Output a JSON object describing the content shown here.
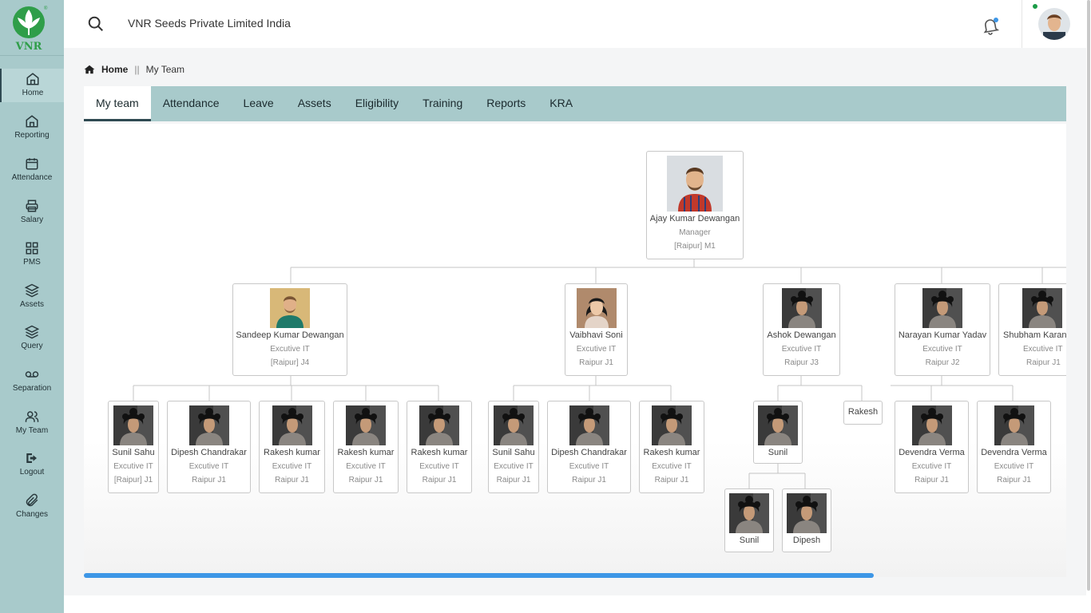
{
  "app": {
    "company_name": "VNR Seeds Private Limited India",
    "logo_text": "VNR"
  },
  "sidebar": {
    "items": [
      {
        "label": "Home",
        "icon": "home-icon",
        "active": true
      },
      {
        "label": "Reporting",
        "icon": "home-icon"
      },
      {
        "label": "Attendance",
        "icon": "calendar-icon"
      },
      {
        "label": "Salary",
        "icon": "printer-icon"
      },
      {
        "label": "PMS",
        "icon": "grid-icon"
      },
      {
        "label": "Assets",
        "icon": "layers-icon"
      },
      {
        "label": "Query",
        "icon": "layers-icon"
      },
      {
        "label": "Separation",
        "icon": "voicemail-icon"
      },
      {
        "label": "My Team",
        "icon": "users-icon"
      },
      {
        "label": "Logout",
        "icon": "logout-icon"
      },
      {
        "label": "Changes",
        "icon": "paperclip-icon"
      }
    ]
  },
  "breadcrumb": {
    "home": "Home",
    "separator": "||",
    "current": "My Team"
  },
  "tabs": [
    "My team",
    "Attendance",
    "Leave",
    "Assets",
    "Eligibility",
    "Training",
    "Reports",
    "KRA"
  ],
  "active_tab": "My team",
  "org_chart": {
    "root": {
      "name": "Ajay Kumar Dewangan",
      "designation": "Manager",
      "location": "[Raipur] M1"
    },
    "level1": [
      {
        "name": "Sandeep Kumar Dewangan",
        "designation": "Excutive IT",
        "location": "[Raipur] J4"
      },
      {
        "name": "Vaibhavi Soni",
        "designation": "Excutive IT",
        "location": "Raipur J1"
      },
      {
        "name": "Ashok Dewangan",
        "designation": "Excutive IT",
        "location": "Raipur J3"
      },
      {
        "name": "Narayan Kumar Yadav",
        "designation": "Excutive IT",
        "location": "Raipur J2"
      },
      {
        "name": "Shubham Karan",
        "designation": "Excutive IT",
        "location": "Raipur J1"
      }
    ],
    "level2_sandeep": [
      {
        "name": "Sunil Sahu",
        "designation": "Excutive IT",
        "location": "[Raipur] J1"
      },
      {
        "name": "Dipesh Chandrakar",
        "designation": "Excutive IT",
        "location": "Raipur J1"
      },
      {
        "name": "Rakesh kumar",
        "designation": "Excutive IT",
        "location": "Raipur J1"
      },
      {
        "name": "Rakesh kumar",
        "designation": "Excutive IT",
        "location": "Raipur J1"
      },
      {
        "name": "Rakesh kumar",
        "designation": "Excutive IT",
        "location": "Raipur J1"
      }
    ],
    "level2_vaibhavi": [
      {
        "name": "Sunil Sahu",
        "designation": "Excutive IT",
        "location": "Raipur J1"
      },
      {
        "name": "Dipesh Chandrakar",
        "designation": "Excutive IT",
        "location": "Raipur J1"
      },
      {
        "name": "Rakesh kumar",
        "designation": "Excutive IT",
        "location": "Raipur J1"
      }
    ],
    "level2_ashok": [
      {
        "name": "Sunil"
      },
      {
        "name": "Rakesh"
      }
    ],
    "level2_narayan": [
      {
        "name": "Devendra Verma",
        "designation": "Excutive IT",
        "location": "Raipur J1"
      },
      {
        "name": "Devendra Verma",
        "designation": "Excutive IT",
        "location": "Raipur J1"
      }
    ],
    "level3_sunil": [
      {
        "name": "Sunil"
      },
      {
        "name": "Dipesh"
      }
    ]
  },
  "colors": {
    "sidebar": "#a8cacb",
    "tab_bar": "#a8cacb",
    "scroll_thumb": "#3d96e6",
    "notification_dot": "#3d96e6",
    "online_dot": "#1b9c47"
  }
}
